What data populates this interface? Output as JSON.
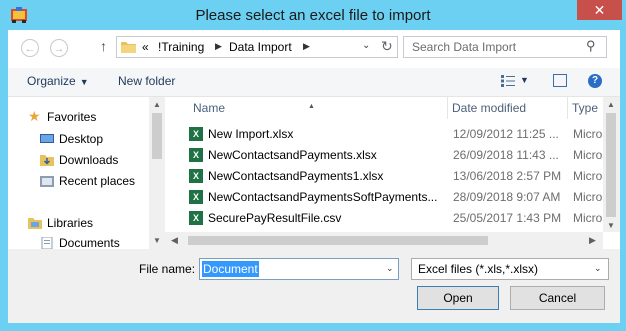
{
  "window": {
    "title": "Please select an excel file to import",
    "close_glyph": "✕"
  },
  "nav": {
    "back_glyph": "←",
    "forward_glyph": "→",
    "up_glyph": "↑"
  },
  "address": {
    "overflow": "«",
    "crumbs": [
      "!Training",
      "Data Import"
    ],
    "crumb_arrow": "▶",
    "dropdown_glyph": "⌄",
    "refresh_glyph": "↻"
  },
  "search": {
    "placeholder": "Search Data Import",
    "icon_glyph": "⚲"
  },
  "toolbar": {
    "organize_label": "Organize",
    "new_folder_label": "New folder",
    "caret_glyph": "▼",
    "help_glyph": "?"
  },
  "sidebar": {
    "favorites": "Favorites",
    "items": [
      {
        "label": "Desktop",
        "icon": "desktop-icon"
      },
      {
        "label": "Downloads",
        "icon": "downloads-icon"
      },
      {
        "label": "Recent places",
        "icon": "recent-places-icon"
      }
    ],
    "libraries": "Libraries",
    "library_items": [
      {
        "label": "Documents",
        "icon": "documents-icon"
      }
    ]
  },
  "filelist": {
    "columns": {
      "name": "Name",
      "date": "Date modified",
      "type": "Type"
    },
    "sort_glyph": "▲",
    "rows": [
      {
        "name": "New Import.xlsx",
        "date": "12/09/2012 11:25 ...",
        "type": "Micros"
      },
      {
        "name": "NewContactsandPayments.xlsx",
        "date": "26/09/2018 11:43 ...",
        "type": "Micros"
      },
      {
        "name": "NewContactsandPayments1.xlsx",
        "date": "13/06/2018 2:57 PM",
        "type": "Micros"
      },
      {
        "name": "NewContactsandPaymentsSoftPayments...",
        "date": "28/09/2018 9:07 AM",
        "type": "Micros"
      },
      {
        "name": "SecurePayResultFile.csv",
        "date": "25/05/2017 1:43 PM",
        "type": "Micros"
      }
    ],
    "file_icon_glyph": "X"
  },
  "scroll": {
    "up": "▲",
    "down": "▼",
    "left": "◀",
    "right": "▶"
  },
  "footer": {
    "filename_label": "File name:",
    "filename_value": "Document",
    "filetype_value": "Excel files (*.xls,*.xlsx)",
    "caret_glyph": "⌄",
    "open_label": "Open",
    "cancel_label": "Cancel"
  },
  "colors": {
    "frame": "#6bd0f2",
    "close": "#c7504a",
    "selection": "#3399ff",
    "excel": "#1f7244"
  }
}
